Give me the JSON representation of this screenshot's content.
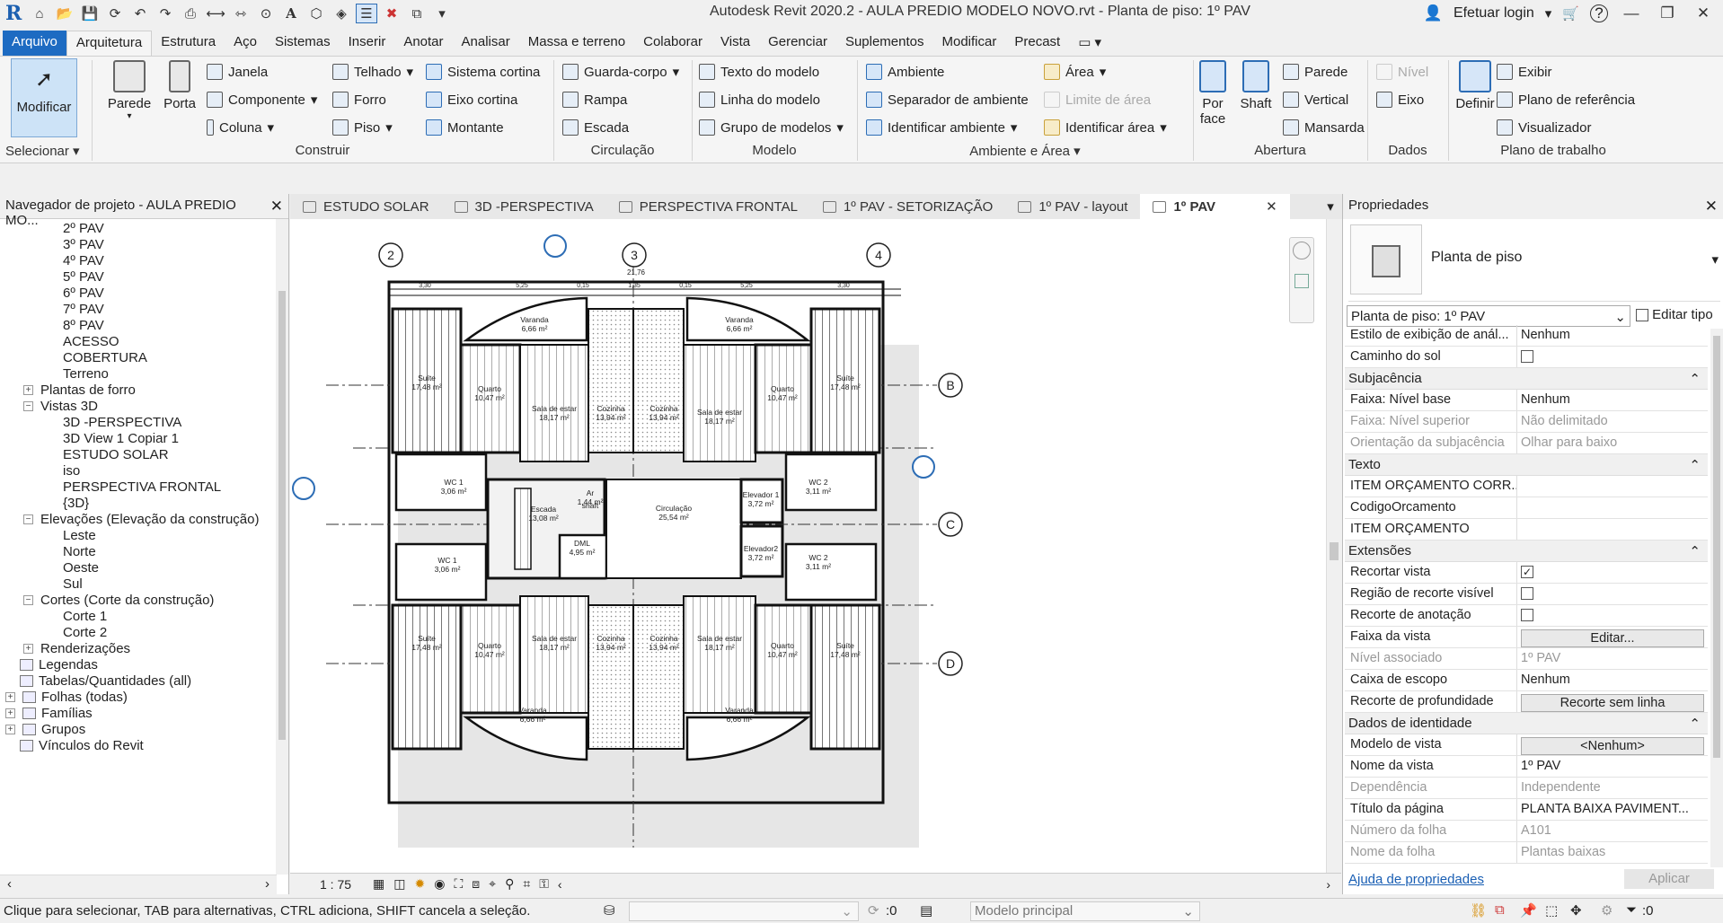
{
  "app": {
    "title": "Autodesk Revit 2020.2 - AULA PREDIO MODELO NOVO.rvt - Planta de piso: 1º PAV",
    "login": "Efetuar login"
  },
  "menu_tabs": [
    "Arquivo",
    "Arquitetura",
    "Estrutura",
    "Aço",
    "Sistemas",
    "Inserir",
    "Anotar",
    "Analisar",
    "Massa e terreno",
    "Colaborar",
    "Vista",
    "Gerenciar",
    "Suplementos",
    "Modificar",
    "Precast"
  ],
  "ribbon": {
    "select": {
      "modify": "Modificar",
      "label": "Selecionar"
    },
    "construir": {
      "label": "Construir",
      "parede": "Parede",
      "porta": "Porta",
      "janela": "Janela",
      "componente": "Componente",
      "coluna": "Coluna",
      "telhado": "Telhado",
      "forro": "Forro",
      "piso": "Piso",
      "sistema_cortina": "Sistema  cortina",
      "eixo_cortina": "Eixo  cortina",
      "montante": "Montante"
    },
    "circulacao": {
      "label": "Circulação",
      "guarda_corpo": "Guarda-corpo",
      "rampa": "Rampa",
      "escada": "Escada"
    },
    "modelo": {
      "label": "Modelo",
      "texto": "Texto do  modelo",
      "linha": "Linha do  modelo",
      "grupo": "Grupo de modelos"
    },
    "ambiente": {
      "label": "Ambiente e Área",
      "ambiente": "Ambiente",
      "separador": "Separador  de ambiente",
      "identificar": "Identificar  ambiente",
      "area": "Área",
      "limite": "Limite  de área",
      "identificar_area": "Identificar  área"
    },
    "abertura": {
      "label": "Abertura",
      "por_face": "Por face",
      "shaft": "Shaft",
      "parede": "Parede",
      "vertical": "Vertical",
      "mansarda": "Mansarda"
    },
    "dados": {
      "label": "Dados",
      "nivel": "Nível",
      "eixo": "Eixo"
    },
    "plano": {
      "label": "Plano de trabalho",
      "definir": "Definir",
      "exibir": "Exibir",
      "plano_ref": "Plano de  referência",
      "visualizador": "Visualizador"
    }
  },
  "browser": {
    "title": "Navegador de projeto - AULA PREDIO MO...",
    "items": [
      {
        "label": "2º PAV",
        "indent": 3
      },
      {
        "label": "3º PAV",
        "indent": 3
      },
      {
        "label": "4º PAV",
        "indent": 3
      },
      {
        "label": "5º PAV",
        "indent": 3
      },
      {
        "label": "6º PAV",
        "indent": 3
      },
      {
        "label": "7º PAV",
        "indent": 3
      },
      {
        "label": "8º PAV",
        "indent": 3
      },
      {
        "label": "ACESSO",
        "indent": 3
      },
      {
        "label": "COBERTURA",
        "indent": 3
      },
      {
        "label": "Terreno",
        "indent": 3
      },
      {
        "label": "Plantas de forro",
        "indent": 2,
        "toggle": "+"
      },
      {
        "label": "Vistas 3D",
        "indent": 2,
        "toggle": "−"
      },
      {
        "label": "3D -PERSPECTIVA",
        "indent": 3
      },
      {
        "label": "3D View 1 Copiar 1",
        "indent": 3
      },
      {
        "label": "ESTUDO SOLAR",
        "indent": 3
      },
      {
        "label": "iso",
        "indent": 3
      },
      {
        "label": "PERSPECTIVA FRONTAL",
        "indent": 3
      },
      {
        "label": "{3D}",
        "indent": 3
      },
      {
        "label": "Elevações (Elevação da construção)",
        "indent": 2,
        "toggle": "−"
      },
      {
        "label": "Leste",
        "indent": 3
      },
      {
        "label": "Norte",
        "indent": 3
      },
      {
        "label": "Oeste",
        "indent": 3
      },
      {
        "label": "Sul",
        "indent": 3
      },
      {
        "label": "Cortes (Corte da construção)",
        "indent": 2,
        "toggle": "−"
      },
      {
        "label": "Corte 1",
        "indent": 3
      },
      {
        "label": "Corte 2",
        "indent": 3
      },
      {
        "label": "Renderizações",
        "indent": 2,
        "toggle": "+"
      },
      {
        "label": "Legendas",
        "indent": 1,
        "icon": true
      },
      {
        "label": "Tabelas/Quantidades (all)",
        "indent": 1,
        "icon": true
      },
      {
        "label": "Folhas (todas)",
        "indent": 0,
        "toggle": "+",
        "icon": true
      },
      {
        "label": "Famílias",
        "indent": 0,
        "toggle": "+",
        "icon": true
      },
      {
        "label": "Grupos",
        "indent": 0,
        "toggle": "+",
        "icon": true
      },
      {
        "label": "Vínculos do Revit",
        "indent": 1,
        "icon": true
      }
    ]
  },
  "view_tabs": [
    {
      "label": "ESTUDO SOLAR"
    },
    {
      "label": "3D -PERSPECTIVA"
    },
    {
      "label": "PERSPECTIVA FRONTAL"
    },
    {
      "label": "1º PAV - SETORIZAÇÃO"
    },
    {
      "label": "1º PAV - layout"
    },
    {
      "label": "1º PAV",
      "active": true
    }
  ],
  "plan": {
    "grids_top": [
      "2",
      "3",
      "4"
    ],
    "grids_right": [
      "B",
      "C",
      "D"
    ],
    "dims": [
      "3,30",
      "5,25",
      "0,15",
      "1,35",
      "0,15",
      "5,25",
      "3,30"
    ],
    "overall": "21,76",
    "rooms": [
      {
        "name": "Varanda",
        "area": "6,66 m²"
      },
      {
        "name": "Suíte",
        "area": "17,48 m²"
      },
      {
        "name": "Quarto",
        "area": "10,47 m²"
      },
      {
        "name": "Sala de estar",
        "area": "18,17 m²"
      },
      {
        "name": "Cozinha",
        "area": "13,94 m²"
      },
      {
        "name": "Circulação",
        "area": "25,54 m²"
      },
      {
        "name": "Escada",
        "area": "13,08 m²"
      },
      {
        "name": "DML",
        "area": "4,95 m²"
      },
      {
        "name": "Elevador 1",
        "area": "3,72 m²"
      },
      {
        "name": "Elevador2",
        "area": "3,72 m²"
      },
      {
        "name": "WC 1",
        "area": "3,06 m²"
      },
      {
        "name": "WC 2",
        "area": "3,11 m²"
      },
      {
        "name": "Ar",
        "area": "1,44 m²"
      },
      {
        "name": "shaft",
        "area": ""
      }
    ]
  },
  "view_control": {
    "scale": "1 : 75"
  },
  "properties": {
    "title": "Propriedades",
    "type_name": "Planta de piso",
    "selector": "Planta de piso: 1º PAV",
    "edit_type": "Editar tipo",
    "rows": [
      {
        "k": "Estilo de exibição de anál...",
        "v": "Nenhum"
      },
      {
        "k": "Caminho do sol",
        "v": "",
        "check": false
      },
      {
        "group": "Subjacência"
      },
      {
        "k": "Faixa: Nível base",
        "v": "Nenhum"
      },
      {
        "k": "Faixa: Nível superior",
        "v": "Não delimitado",
        "grey": true
      },
      {
        "k": "Orientação da subjacência",
        "v": "Olhar para baixo",
        "grey": true
      },
      {
        "group": "Texto"
      },
      {
        "k": "ITEM ORÇAMENTO CORR...",
        "v": ""
      },
      {
        "k": "CodigoOrcamento",
        "v": ""
      },
      {
        "k": "ITEM ORÇAMENTO",
        "v": ""
      },
      {
        "group": "Extensões"
      },
      {
        "k": "Recortar vista",
        "v": "",
        "check": true
      },
      {
        "k": "Região de recorte visível",
        "v": "",
        "check": false
      },
      {
        "k": "Recorte de anotação",
        "v": "",
        "check": false
      },
      {
        "k": "Faixa da vista",
        "v": "Editar...",
        "button": true
      },
      {
        "k": "Nível associado",
        "v": "1º PAV",
        "grey": true
      },
      {
        "k": "Caixa de escopo",
        "v": "Nenhum"
      },
      {
        "k": "Recorte de profundidade",
        "v": "Recorte sem linha",
        "button": true
      },
      {
        "group": "Dados de identidade"
      },
      {
        "k": "Modelo de vista",
        "v": "<Nenhum>",
        "button": true
      },
      {
        "k": "Nome da vista",
        "v": "1º PAV"
      },
      {
        "k": "Dependência",
        "v": "Independente",
        "grey": true
      },
      {
        "k": "Título da página",
        "v": "PLANTA BAIXA PAVIMENT..."
      },
      {
        "k": "Número da folha",
        "v": "A101",
        "grey": true
      },
      {
        "k": "Nome da folha",
        "v": "Plantas baixas",
        "grey": true
      }
    ],
    "help": "Ajuda de propriedades",
    "apply": "Aplicar"
  },
  "status": {
    "hint": "Clique para selecionar, TAB para alternativas, CTRL adiciona, SHIFT cancela a seleção.",
    "count_left": ":0",
    "model": "Modelo principal",
    "filter": ":0"
  }
}
